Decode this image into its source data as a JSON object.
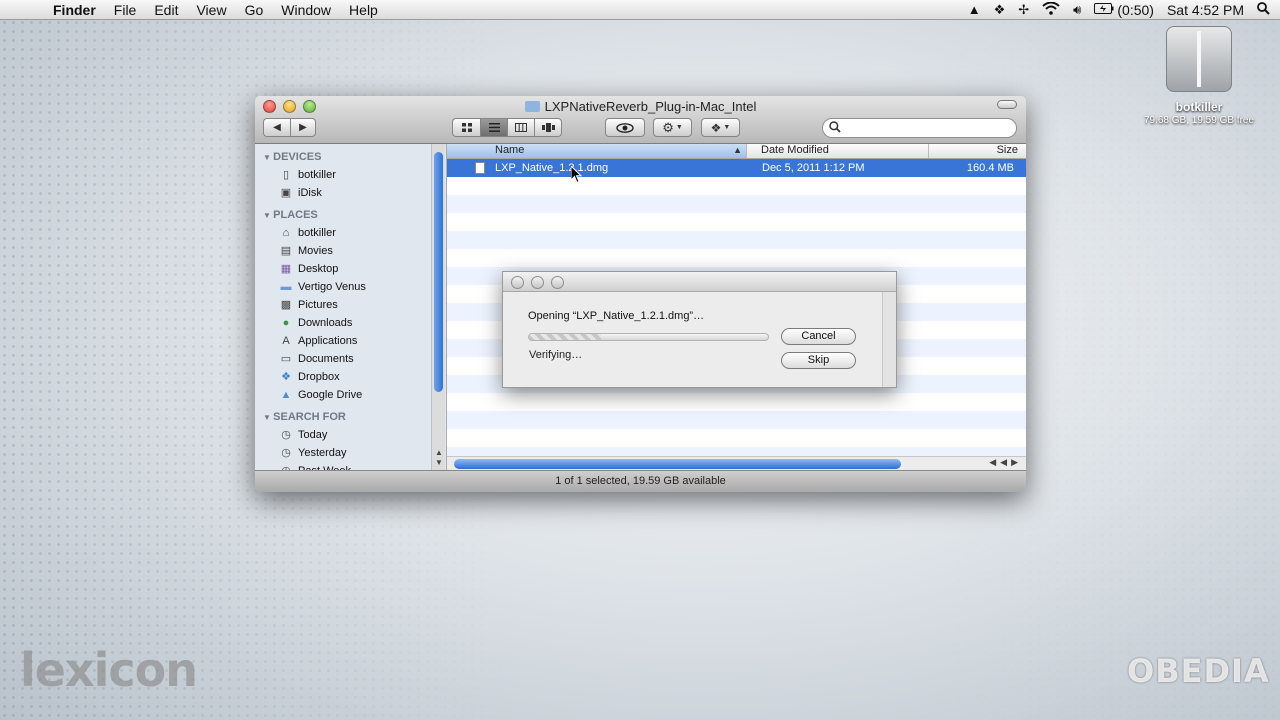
{
  "menubar": {
    "app_name": "Finder",
    "menus": [
      "File",
      "Edit",
      "View",
      "Go",
      "Window",
      "Help"
    ],
    "battery_time": "(0:50)",
    "clock": "Sat 4:52 PM"
  },
  "desktop": {
    "drive_name": "botkiller",
    "drive_info": "79.68 GB, 19.59 GB free"
  },
  "finder": {
    "title": "LXPNativeReverb_Plug-in-Mac_Intel",
    "search_placeholder": "",
    "sidebar": {
      "devices_header": "DEVICES",
      "devices": [
        "botkiller",
        "iDisk"
      ],
      "places_header": "PLACES",
      "places": [
        "botkiller",
        "Movies",
        "Desktop",
        "Vertigo Venus",
        "Pictures",
        "Downloads",
        "Applications",
        "Documents",
        "Dropbox",
        "Google Drive"
      ],
      "search_header": "SEARCH FOR",
      "search": [
        "Today",
        "Yesterday",
        "Past Week"
      ]
    },
    "columns": {
      "name": "Name",
      "date": "Date Modified",
      "size": "Size"
    },
    "files": [
      {
        "name": "LXP_Native_1.2.1.dmg",
        "date": "Dec 5, 2011 1:12 PM",
        "size": "160.4 MB"
      }
    ],
    "status": "1 of 1 selected, 19.59 GB available"
  },
  "dialog": {
    "message": "Opening “LXP_Native_1.2.1.dmg”…",
    "status": "Verifying…",
    "cancel_label": "Cancel",
    "skip_label": "Skip",
    "progress": 0.3
  },
  "watermarks": {
    "left": "lexicon",
    "right": "OBEDIA"
  }
}
